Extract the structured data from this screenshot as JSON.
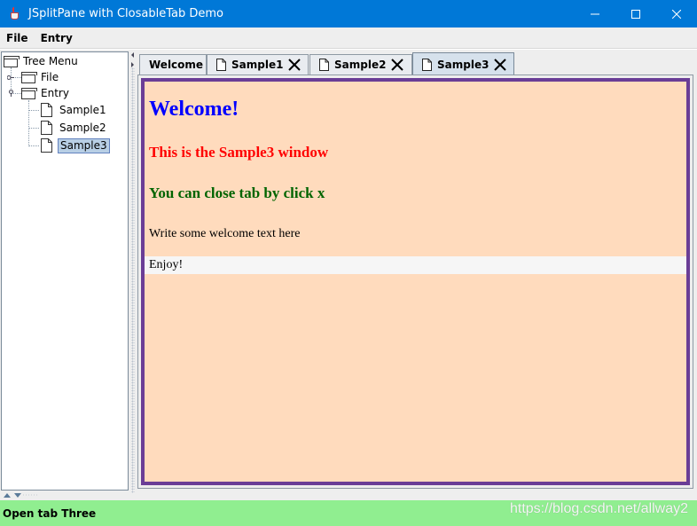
{
  "window": {
    "title": "JSplitPane with ClosableTab Demo"
  },
  "menu": {
    "items": [
      "File",
      "Entry"
    ]
  },
  "tree": {
    "root": "Tree Menu",
    "nodes": [
      {
        "label": "File",
        "type": "folder",
        "expanded": false
      },
      {
        "label": "Entry",
        "type": "folder",
        "expanded": true
      },
      {
        "label": "Sample1",
        "type": "leaf"
      },
      {
        "label": "Sample2",
        "type": "leaf"
      },
      {
        "label": "Sample3",
        "type": "leaf",
        "selected": true
      }
    ]
  },
  "tabs": [
    {
      "label": "Welcome",
      "closable": false,
      "active": false
    },
    {
      "label": "Sample1",
      "closable": true,
      "active": false
    },
    {
      "label": "Sample2",
      "closable": true,
      "active": false
    },
    {
      "label": "Sample3",
      "closable": true,
      "active": true
    }
  ],
  "content": {
    "heading": "Welcome!",
    "line1": "This is the Sample3 window",
    "line2": "You can close tab by click x",
    "line3": "Write some welcome text here",
    "line4": "Enjoy!"
  },
  "status": {
    "text": "Open tab Three"
  },
  "watermark": "https://blog.csdn.net/allway2",
  "colors": {
    "titlebar": "#0078d7",
    "content_bg": "#ffdbbd",
    "content_border": "#6a3d96",
    "heading": "#0000ff",
    "line1": "#ff0000",
    "line2": "#006400",
    "status_bg": "#90ee90"
  }
}
